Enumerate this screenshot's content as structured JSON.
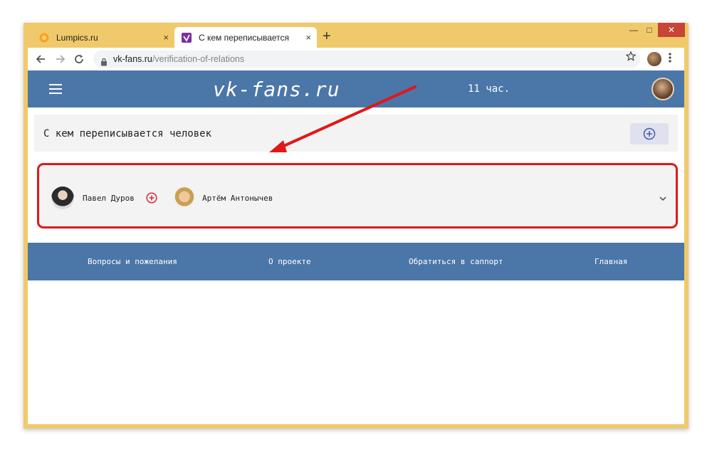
{
  "browser": {
    "tabs": [
      {
        "title": "Lumpics.ru",
        "active": false
      },
      {
        "title": "С кем переписывается",
        "active": true
      }
    ],
    "tab_close_glyph": "×",
    "new_tab_glyph": "+",
    "window_controls": {
      "minimize": "—",
      "maximize": "□",
      "close": "✕"
    },
    "url_host": "vk-fans.ru",
    "url_path": "/verification-of-relations",
    "colors": {
      "frame": "#f0c96a",
      "close_button": "#c84436"
    }
  },
  "site": {
    "logo": "vk-fans.ru",
    "time": "11 час.",
    "colors": {
      "brand": "#4b76a8",
      "card": "#f3f3f3",
      "highlight_border": "#e01818"
    }
  },
  "main": {
    "title": "С кем переписывается человек",
    "pair": {
      "person_a": "Павел Дуров",
      "person_b": "Артём Антонычев"
    }
  },
  "footer": {
    "links": [
      "Вопросы и пожелания",
      "О проекте",
      "Обратиться в саппорт",
      "Главная"
    ]
  },
  "icons": [
    "hamburger-icon",
    "plus-circle-icon",
    "chevron-down-icon",
    "lock-icon",
    "star-icon",
    "kebab-menu-icon",
    "back-arrow-icon",
    "forward-arrow-icon",
    "reload-icon"
  ]
}
